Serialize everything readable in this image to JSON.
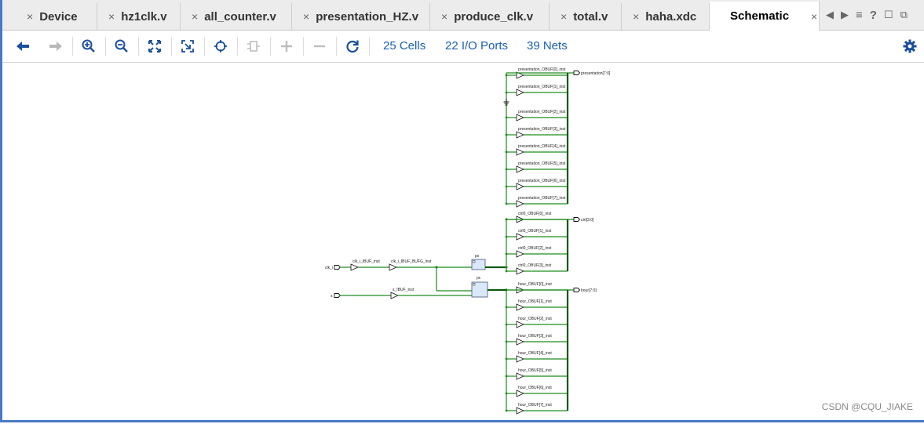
{
  "tabs": [
    {
      "label": "Device",
      "active": false
    },
    {
      "label": "hz1clk.v",
      "active": false
    },
    {
      "label": "all_counter.v",
      "active": false
    },
    {
      "label": "presentation_HZ.v",
      "active": false
    },
    {
      "label": "produce_clk.v",
      "active": false
    },
    {
      "label": "total.v",
      "active": false
    },
    {
      "label": "haha.xdc",
      "active": false
    },
    {
      "label": "Schematic",
      "active": true
    }
  ],
  "tab_close_glyph": "×",
  "tab_nav": {
    "prev": "◀",
    "next": "▶",
    "menu": "≡",
    "help": "?",
    "restore": "☐",
    "float": "⧉"
  },
  "toolbar": {
    "icons": [
      "back-arrow",
      "forward-arrow",
      "zoom-in",
      "zoom-out",
      "fit",
      "zoom-area",
      "auto-fit",
      "route",
      "add",
      "remove",
      "refresh"
    ],
    "cells": "25 Cells",
    "io_ports": "22 I/O Ports",
    "nets": "39 Nets",
    "settings_icon": "gear-icon"
  },
  "schematic": {
    "presentation_buffers": [
      "presentation_OBUF[0]_inst",
      "presentation_OBUF[1]_inst",
      "presentation_OBUF[2]_inst",
      "presentation_OBUF[3]_inst",
      "presentation_OBUF[4]_inst",
      "presentation_OBUF[5]_inst",
      "presentation_OBUF[6]_inst",
      "presentation_OBUF[7]_inst"
    ],
    "presentation_port": "presentation[7:0]",
    "ctrl_buffers": [
      "ctrl0_OBUF[0]_inst",
      "ctrl0_OBUF[1]_inst",
      "ctrl0_OBUF[2]_inst",
      "ctrl0_OBUF[3]_inst"
    ],
    "ctrl_port": "ctrl[3:0]",
    "hour_buffers": [
      "hour_OBUF[0]_inst",
      "hour_OBUF[1]_inst",
      "hour_OBUF[2]_inst",
      "hour_OBUF[3]_inst",
      "hour_OBUF[4]_inst",
      "hour_OBUF[5]_inst",
      "hour_OBUF[6]_inst",
      "hour_OBUF[7]_inst"
    ],
    "hour_port": "hour[7:0]",
    "clk_port": "clk_i",
    "clk_ibuf": "clk_i_IBUF_inst",
    "clk_bufg": "clk_i_IBUF_BUFG_inst",
    "s_port": "s",
    "s_ibuf": "s_IBUF_inst",
    "block_ps": "ps",
    "block_pc": "pc"
  },
  "watermark": "CSDN @CQU_JIAKE"
}
